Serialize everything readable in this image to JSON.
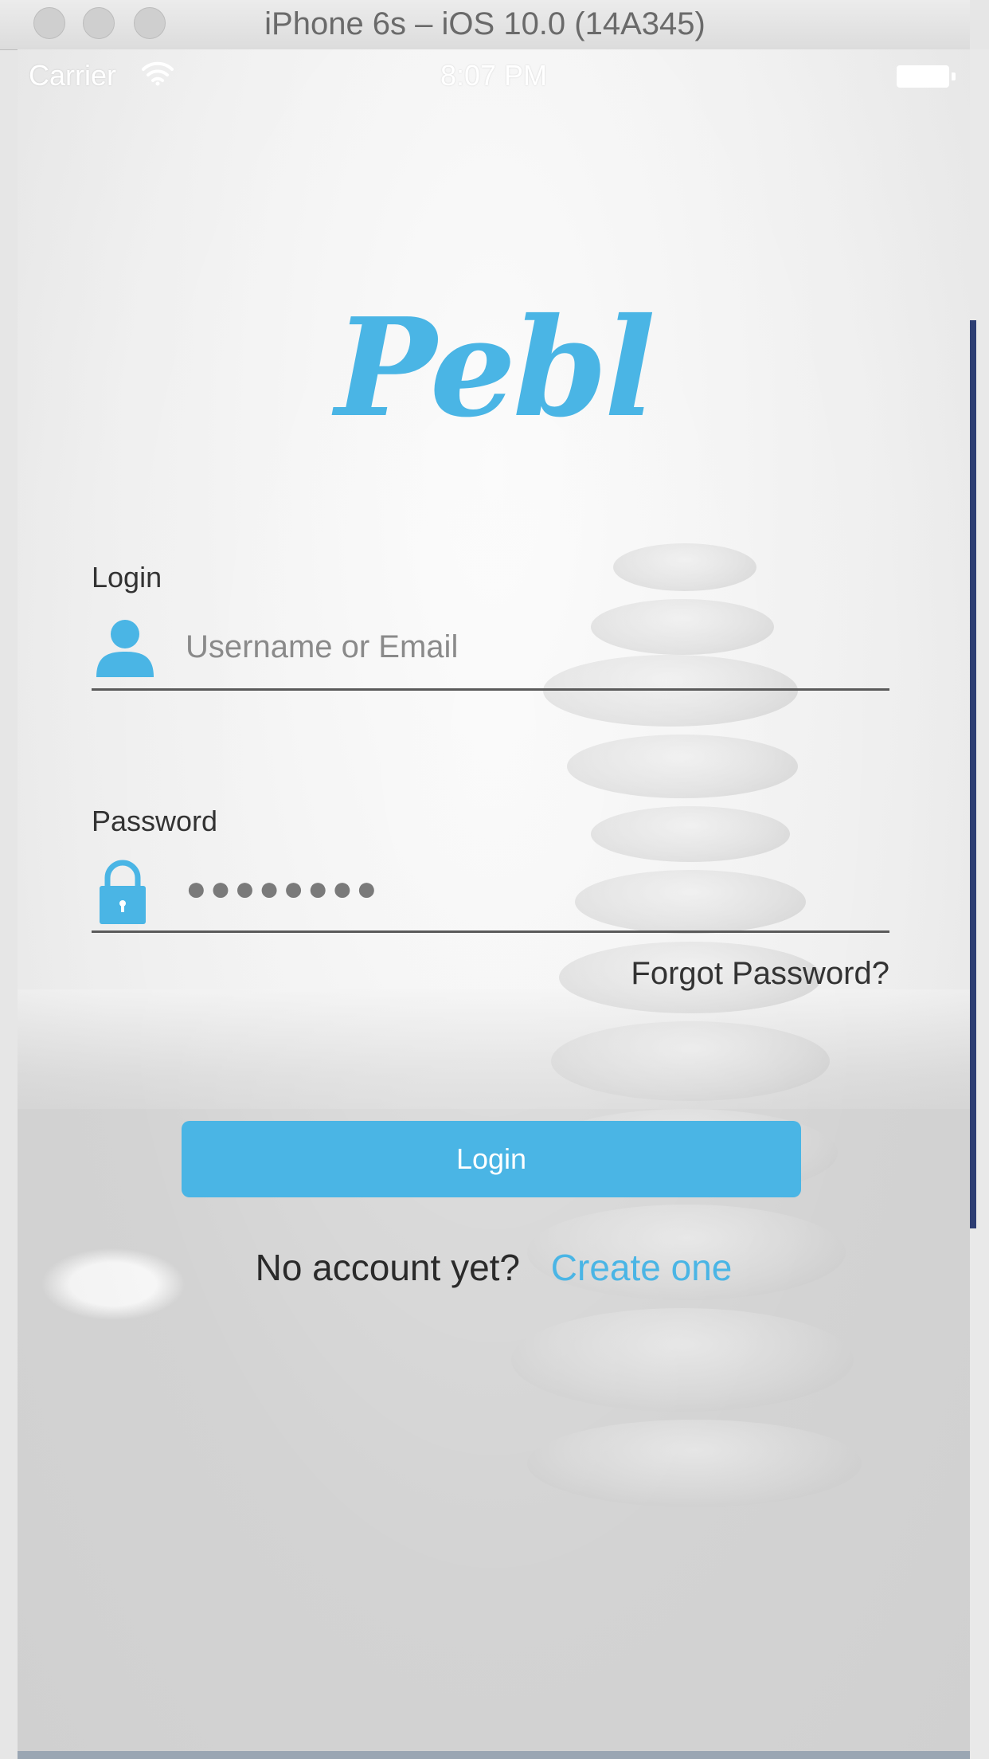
{
  "window": {
    "title": "iPhone 6s – iOS 10.0 (14A345)"
  },
  "status_bar": {
    "carrier": "Carrier",
    "time": "8:07 PM",
    "wifi_icon": "wifi-icon",
    "battery_icon": "battery-icon"
  },
  "app": {
    "logo_text": "Pebl",
    "accent_color": "#4ab5e5"
  },
  "login_field": {
    "label": "Login",
    "placeholder": "Username or Email",
    "icon": "user-icon"
  },
  "password_field": {
    "label": "Password",
    "value": "●●●●●●●●",
    "icon": "lock-icon"
  },
  "forgot_password": "Forgot Password?",
  "login_button": "Login",
  "signup": {
    "question": "No account yet?",
    "link": "Create one"
  }
}
